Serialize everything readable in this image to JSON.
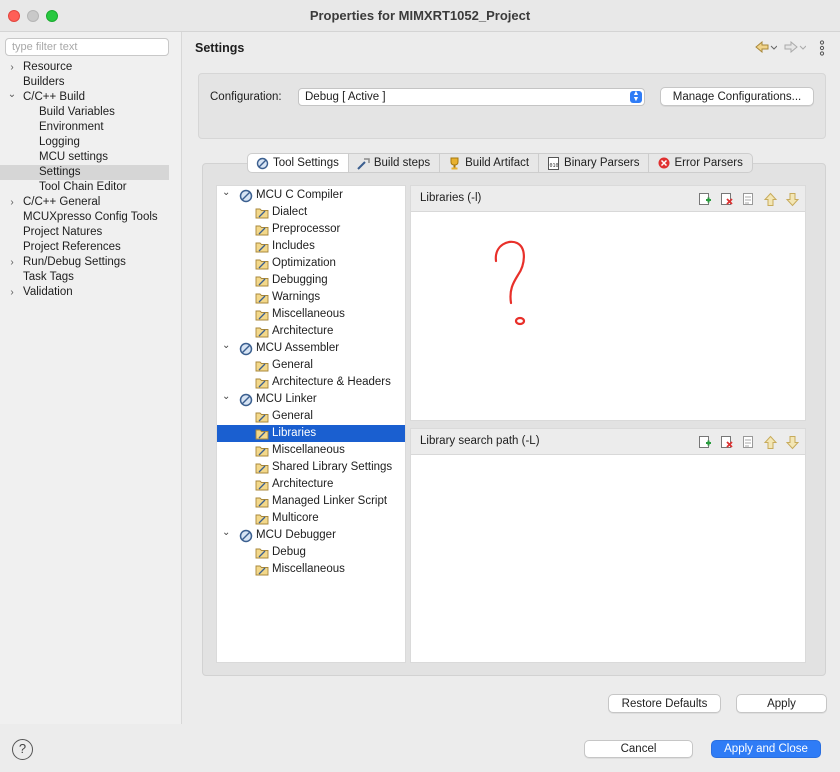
{
  "window": {
    "title": "Properties for MIMXRT1052_Project"
  },
  "sidebar": {
    "filter_placeholder": "type filter text",
    "items": [
      {
        "label": "Resource",
        "expandable": true
      },
      {
        "label": "Builders",
        "expandable": false
      },
      {
        "label": "C/C++ Build",
        "expandable": true,
        "expanded": true
      },
      {
        "label": "Build Variables"
      },
      {
        "label": "Environment"
      },
      {
        "label": "Logging"
      },
      {
        "label": "MCU settings"
      },
      {
        "label": "Settings",
        "selected": true
      },
      {
        "label": "Tool Chain Editor"
      },
      {
        "label": "C/C++ General",
        "expandable": true
      },
      {
        "label": "MCUXpresso Config Tools"
      },
      {
        "label": "Project Natures"
      },
      {
        "label": "Project References"
      },
      {
        "label": "Run/Debug Settings",
        "expandable": true
      },
      {
        "label": "Task Tags"
      },
      {
        "label": "Validation",
        "expandable": true
      }
    ]
  },
  "header": {
    "title": "Settings",
    "back_icon": "back-arrow-icon",
    "forward_icon": "forward-arrow-icon",
    "menu_icon": "vertical-dots-icon"
  },
  "configuration": {
    "label": "Configuration:",
    "value": "Debug  [ Active ]",
    "manage_button": "Manage Configurations..."
  },
  "tabs": [
    {
      "label": "Tool Settings",
      "icon": "tool-settings-icon",
      "active": true
    },
    {
      "label": "Build steps",
      "icon": "build-steps-icon"
    },
    {
      "label": "Build Artifact",
      "icon": "trophy-icon"
    },
    {
      "label": "Binary Parsers",
      "icon": "binary-icon"
    },
    {
      "label": "Error Parsers",
      "icon": "error-icon"
    }
  ],
  "tool_tree": [
    {
      "label": "MCU C Compiler",
      "group": true
    },
    {
      "label": "Dialect"
    },
    {
      "label": "Preprocessor"
    },
    {
      "label": "Includes"
    },
    {
      "label": "Optimization"
    },
    {
      "label": "Debugging"
    },
    {
      "label": "Warnings"
    },
    {
      "label": "Miscellaneous"
    },
    {
      "label": "Architecture"
    },
    {
      "label": "MCU Assembler",
      "group": true
    },
    {
      "label": "General"
    },
    {
      "label": "Architecture & Headers"
    },
    {
      "label": "MCU Linker",
      "group": true
    },
    {
      "label": "General"
    },
    {
      "label": "Libraries",
      "selected": true
    },
    {
      "label": "Miscellaneous"
    },
    {
      "label": "Shared Library Settings"
    },
    {
      "label": "Architecture"
    },
    {
      "label": "Managed Linker Script"
    },
    {
      "label": "Multicore"
    },
    {
      "label": "MCU Debugger",
      "group": true
    },
    {
      "label": "Debug"
    },
    {
      "label": "Miscellaneous"
    }
  ],
  "libraries_panel": {
    "title": "Libraries (-l)",
    "tools": [
      "add-icon",
      "delete-icon",
      "edit-icon",
      "move-up-icon",
      "move-down-icon"
    ]
  },
  "search_path_panel": {
    "title": "Library search path (-L)",
    "tools": [
      "add-icon",
      "delete-icon",
      "edit-icon",
      "move-up-icon",
      "move-down-icon"
    ]
  },
  "buttons": {
    "restore_defaults": "Restore Defaults",
    "apply": "Apply",
    "cancel": "Cancel",
    "apply_and_close": "Apply and Close",
    "help": "?"
  },
  "colors": {
    "accent": "#1a5fd0",
    "primary_button": "#2f7cf6",
    "annotation": "#e8302a"
  }
}
